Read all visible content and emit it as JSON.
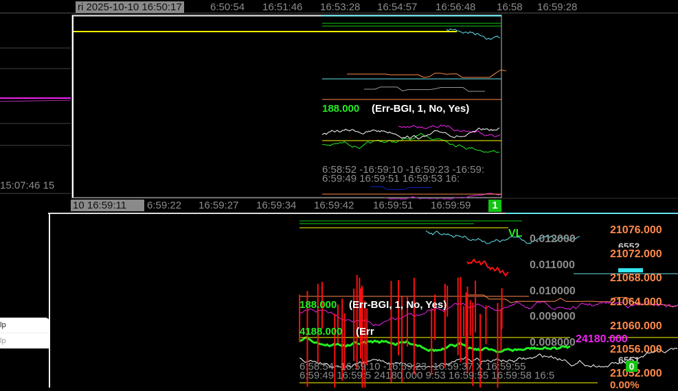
{
  "top_axis": {
    "highlight": "ri 2025-10-10  16:50:17",
    "ticks": [
      "6:50:54",
      "16:51:46",
      "16:53:28",
      "16:54:57",
      "16:56:48",
      "16:58",
      "16:59:28"
    ]
  },
  "left_window": {
    "time_label": "15:07:46  15"
  },
  "upper_window": {
    "indicator": {
      "value": "188.000",
      "params": "(Err-BGI, 1, No, Yes)"
    },
    "sub_axis_1": "6:58:52 -16:59:10 -16:59:23 -16:59:",
    "sub_axis_2": "6:59:49   16:59:51   16:59:53   16:",
    "bottom_axis": {
      "highlight": "10  16:59:11",
      "ticks": [
        "6:59:22",
        "16:59:27",
        "16:59:34",
        "16:59:42",
        "16:59:51",
        "16:59:59"
      ],
      "badge": "1"
    }
  },
  "lower_window": {
    "vl_label": "VL",
    "indicator_1": {
      "value": "188.000",
      "params": "(Err-BGI, 1, No, Yes)"
    },
    "indicator_2": {
      "value": "4188.000",
      "params": "(Err"
    },
    "volatility_scale": [
      "0.012000",
      "0.011000",
      "0.010000",
      "0.009000",
      "0.008000"
    ],
    "price_scale": [
      "21076.000",
      "21072.000",
      "21068.000",
      "21064.000",
      "21060.000",
      "21056.000",
      "21052.000"
    ],
    "magenta_value": "24180.000",
    "vol_label_top": "6552",
    "vol_label_bottom": "6551",
    "badge": "0",
    "percent": "0.00%",
    "sub_axis_1": "6:58:54 -16:59:10 -16:59:23 -16:59:37  X 16:59:55",
    "sub_axis_2": "6:59:49   16:59:5  24180.000 9:53   16:59:55   16:59:58   16:5"
  },
  "popup": {
    "items": [
      "lp",
      "lp"
    ]
  },
  "colors": {
    "price": "#ff8a4a",
    "green": "#22ee22",
    "magenta": "#ee22ee",
    "yellow": "#ffff00",
    "cyan": "#66e6f0",
    "red": "#ff1010",
    "axis": "#8c8c8c"
  }
}
